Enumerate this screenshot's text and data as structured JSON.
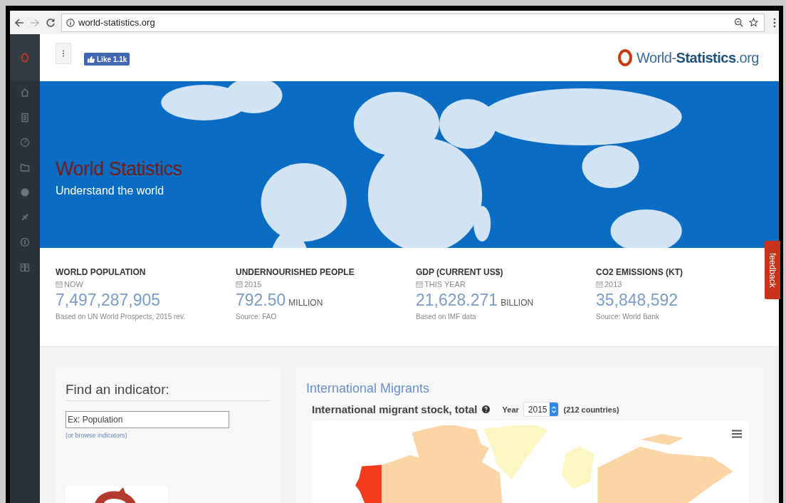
{
  "browser": {
    "url": "world-statistics.org"
  },
  "header": {
    "like_button": "Like 1.1k",
    "logo": {
      "part_1": "World-",
      "part_2": "Statistics",
      ".org": ".org"
    }
  },
  "hero": {
    "title": "World Statistics",
    "subtitle": "Understand the world"
  },
  "stats": [
    {
      "title": "WORLD POPULATION",
      "date": "NOW",
      "value": "7,497,287,905",
      "note": "Based on UN World Prospects, 2015 rev."
    },
    {
      "title": "UNDERNOURISHED PEOPLE",
      "date": "2015",
      "value": "792.50",
      "unit": "MILLION",
      "note": "Source: FAO"
    },
    {
      "title": "GDP (CURRENT US$)",
      "date": "THIS YEAR",
      "value": "21,628.271",
      "unit": "BILLION",
      "note": "Based on IMF data"
    },
    {
      "title": "CO2 EMISSIONS (KT)",
      "date": "2013",
      "value": "35,848,592",
      "note": "Source: World Bank"
    }
  ],
  "feedback_tab": "feedback",
  "indicator_panel": {
    "heading": "Find an indicator:",
    "search": {
      "placeholder": "Ex: Population"
    },
    "browse_link": "(or browse indicators)"
  },
  "migrants_panel": {
    "heading": "International Migrants",
    "chart_title": "International migrant stock, total",
    "year": {
      "label": "Year",
      "value": "2015"
    },
    "count": "(212 countries)"
  }
}
